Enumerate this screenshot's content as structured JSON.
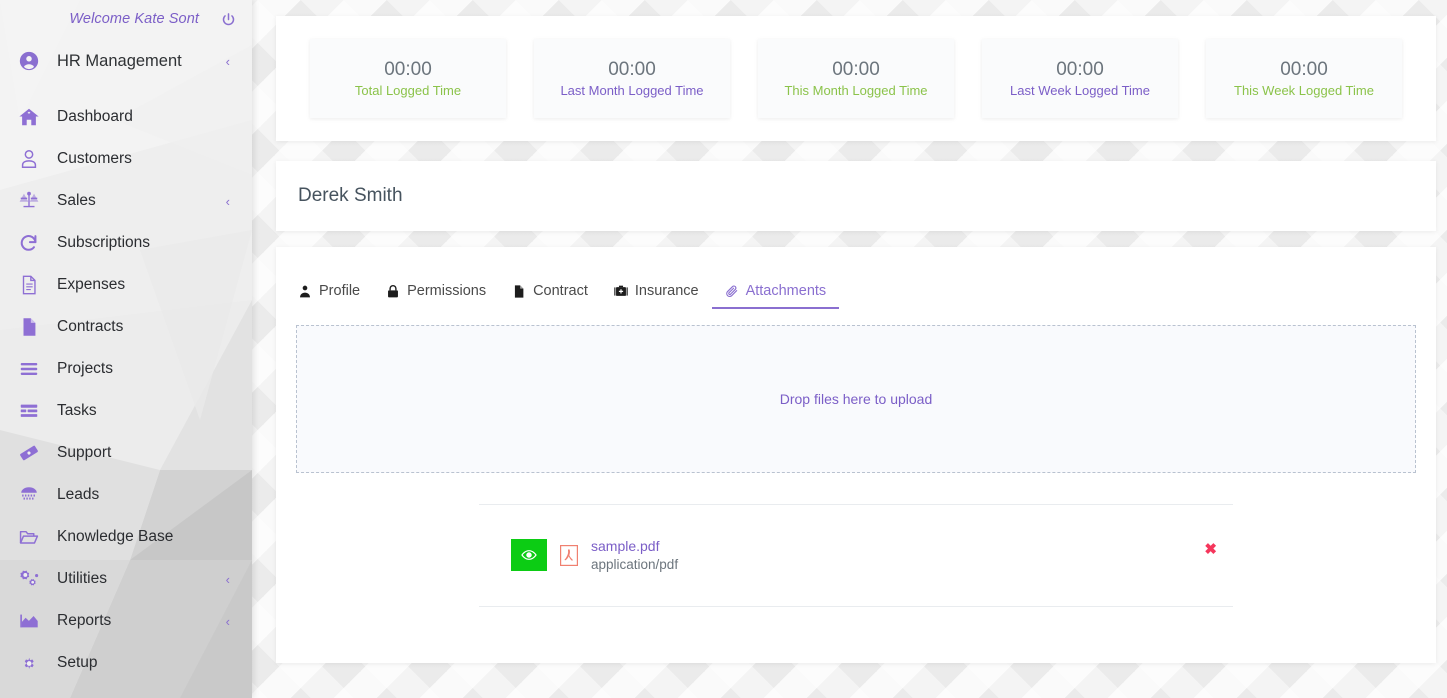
{
  "sidebar": {
    "welcome": "Welcome Kate Sont",
    "power_icon": "power-icon",
    "brand": {
      "label": "HR Management",
      "icon": "user-circle-icon",
      "caret": "‹"
    },
    "items": [
      {
        "label": "Dashboard",
        "icon": "home-icon",
        "caret": ""
      },
      {
        "label": "Customers",
        "icon": "user-icon",
        "caret": ""
      },
      {
        "label": "Sales",
        "icon": "scales-icon",
        "caret": "‹"
      },
      {
        "label": "Subscriptions",
        "icon": "refresh-icon",
        "caret": ""
      },
      {
        "label": "Expenses",
        "icon": "document-icon",
        "caret": ""
      },
      {
        "label": "Contracts",
        "icon": "file-icon",
        "caret": ""
      },
      {
        "label": "Projects",
        "icon": "bars-icon",
        "caret": ""
      },
      {
        "label": "Tasks",
        "icon": "list-icon",
        "caret": ""
      },
      {
        "label": "Support",
        "icon": "ticket-icon",
        "caret": ""
      },
      {
        "label": "Leads",
        "icon": "funnel-icon",
        "caret": ""
      },
      {
        "label": "Knowledge Base",
        "icon": "folder-open-icon",
        "caret": ""
      },
      {
        "label": "Utilities",
        "icon": "gears-icon",
        "caret": "‹"
      },
      {
        "label": "Reports",
        "icon": "chart-area-icon",
        "caret": "‹"
      },
      {
        "label": "Setup",
        "icon": "gear-icon",
        "caret": ""
      }
    ]
  },
  "stats": [
    {
      "value": "00:00",
      "label": "Total Logged Time",
      "color": "green"
    },
    {
      "value": "00:00",
      "label": "Last Month Logged Time",
      "color": "purple"
    },
    {
      "value": "00:00",
      "label": "This Month Logged Time",
      "color": "green"
    },
    {
      "value": "00:00",
      "label": "Last Week Logged Time",
      "color": "purple"
    },
    {
      "value": "00:00",
      "label": "This Week Logged Time",
      "color": "green"
    }
  ],
  "profile": {
    "name": "Derek Smith"
  },
  "tabs": [
    {
      "label": "Profile",
      "icon": "person-icon",
      "active": false
    },
    {
      "label": "Permissions",
      "icon": "lock-icon",
      "active": false
    },
    {
      "label": "Contract",
      "icon": "file-icon",
      "active": false
    },
    {
      "label": "Insurance",
      "icon": "medkit-icon",
      "active": false
    },
    {
      "label": "Attachments",
      "icon": "paperclip-icon",
      "active": true
    }
  ],
  "dropzone": {
    "text": "Drop files here to upload"
  },
  "attachments": [
    {
      "name": "sample.pdf",
      "mime": "application/pdf",
      "view_icon": "eye-icon",
      "file_icon": "pdf-icon",
      "delete_icon": "close-icon",
      "delete_label": "✖"
    }
  ],
  "colors": {
    "accent_purple": "#7b5ec7",
    "accent_green": "#8bc34a",
    "view_green": "#0ccc14",
    "delete_red": "#f5365c",
    "pdf_red": "#f08070"
  }
}
